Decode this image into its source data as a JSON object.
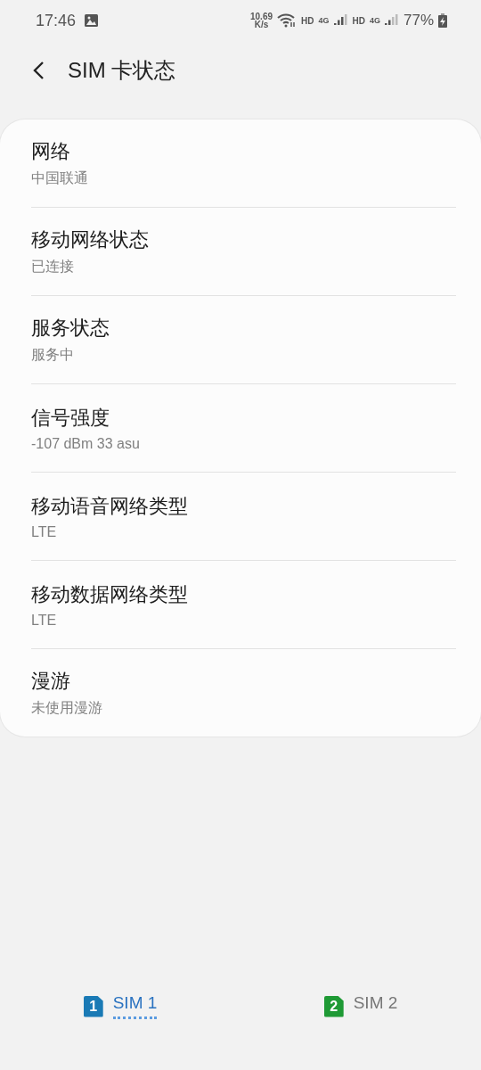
{
  "status_bar": {
    "time": "17:46",
    "speed_value": "10.69",
    "speed_unit": "K/s",
    "hd_1": "HD",
    "net_1": "4G",
    "hd_2": "HD",
    "net_2": "4G",
    "battery": "77%"
  },
  "header": {
    "title": "SIM 卡状态"
  },
  "items": [
    {
      "title": "网络",
      "value": "中国联通"
    },
    {
      "title": "移动网络状态",
      "value": "已连接"
    },
    {
      "title": "服务状态",
      "value": "服务中"
    },
    {
      "title": "信号强度",
      "value": "-107 dBm 33 asu"
    },
    {
      "title": "移动语音网络类型",
      "value": "LTE"
    },
    {
      "title": "移动数据网络类型",
      "value": "LTE"
    },
    {
      "title": "漫游",
      "value": "未使用漫游"
    }
  ],
  "tabs": [
    {
      "badge": "1",
      "label": "SIM 1",
      "selected": true,
      "color": "#1a7ab5"
    },
    {
      "badge": "2",
      "label": "SIM 2",
      "selected": false,
      "color": "#1f9a35"
    }
  ]
}
